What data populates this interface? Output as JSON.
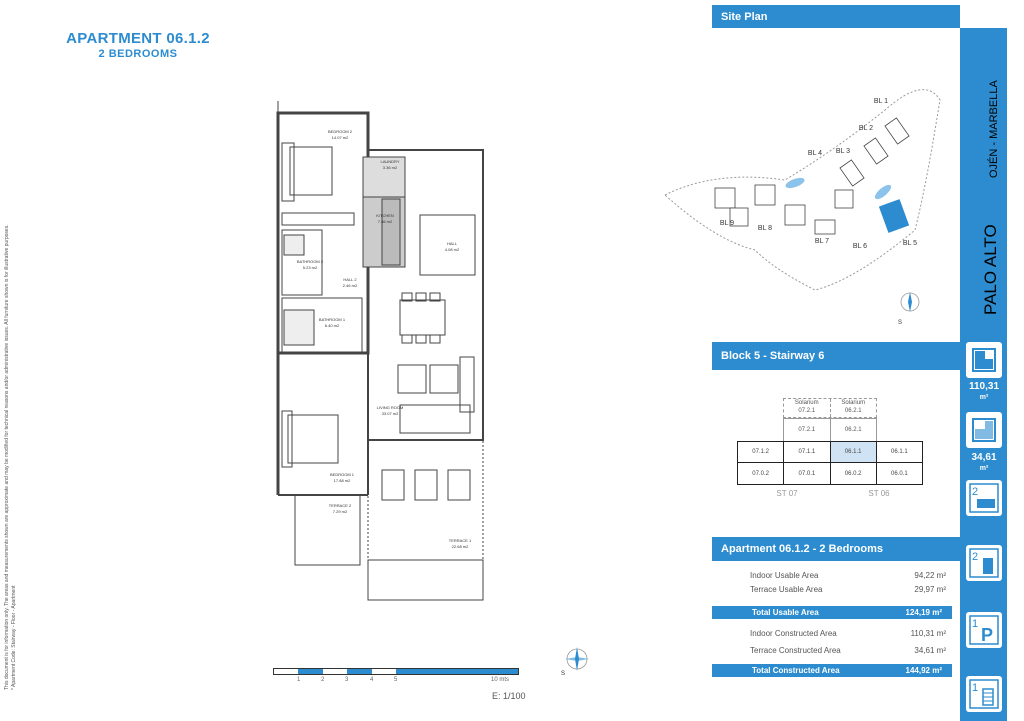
{
  "header": {
    "title": "APARTMENT 06.1.2",
    "subtitle": "2 BEDROOMS"
  },
  "disclaimer": {
    "line1": "This document is for information only. The areas and measurements shown are approximate and may be modified for technical reasons and/or administrative issues. All furniture shown is for illustrative purposes.",
    "line2": "* Apartment Code: Stairway - Floor - Apartment"
  },
  "floorplan": {
    "rooms": [
      {
        "name": "BEDROOM 2",
        "area": "14.07 m2"
      },
      {
        "name": "LAUNDRY",
        "area": "3.36 m2"
      },
      {
        "name": "KITCHEN",
        "area": "7.86 m2"
      },
      {
        "name": "HALL",
        "area": "4.08 m2"
      },
      {
        "name": "BATHROOM 2",
        "area": "5.23 m2"
      },
      {
        "name": "HALL 2",
        "area": "2.46 m2"
      },
      {
        "name": "BATHROOM 1",
        "area": "6.40 m2"
      },
      {
        "name": "LIVING ROOM",
        "area": "33.07 m2"
      },
      {
        "name": "BEDROOM 1",
        "area": "17.88 m2"
      },
      {
        "name": "TERRACE 2",
        "area": "7.29 m2"
      },
      {
        "name": "TERRACE 1",
        "area": "22.68 m2"
      }
    ],
    "scale_ticks": [
      "1",
      "2",
      "3",
      "4",
      "5",
      "10 mts"
    ],
    "scale_label": "E: 1/100",
    "compass_label": "S"
  },
  "site_plan": {
    "title": "Site Plan",
    "blocks": [
      "BL 1",
      "BL 2",
      "BL 3",
      "BL 4",
      "BL 9",
      "BL 8",
      "BL 7",
      "BL 6",
      "BL 5"
    ],
    "compass_label": "S"
  },
  "block_section": {
    "title": "Block 5 - Stairway 6",
    "solarium": [
      {
        "label": "Solarium",
        "code": "07.2.1"
      },
      {
        "label": "Solarium",
        "code": "06.2.1"
      }
    ],
    "row2": [
      "07.2.1",
      "06.2.1"
    ],
    "row1": [
      "07.1.2",
      "07.1.1",
      "06.1.1",
      "06.1.1"
    ],
    "row1_highlight": "06.1.1",
    "row0": [
      "07.0.2",
      "07.0.1",
      "06.0.2",
      "06.0.1"
    ],
    "stairways": [
      "ST 07",
      "ST 06"
    ]
  },
  "apartment_summary": {
    "title": "Apartment 06.1.2 - 2 Bedrooms",
    "indoor_usable_label": "Indoor Usable Area",
    "indoor_usable_value": "94,22 m²",
    "terrace_usable_label": "Terrace Usable Area",
    "terrace_usable_value": "29,97 m²",
    "total_usable_label": "Total Usable Area",
    "total_usable_value": "124,19 m²",
    "indoor_constructed_label": "Indoor Constructed Area",
    "indoor_constructed_value": "110,31 m²",
    "terrace_constructed_label": "Terrace Constructed Area",
    "terrace_constructed_value": "34,61 m²",
    "total_constructed_label": "Total Constructed Area",
    "total_constructed_value": "144,92 m²"
  },
  "brand": {
    "name": "PALO ALTO",
    "location": "OJÉN - MARBELLA"
  },
  "sidebar_icons": [
    {
      "icon": "indoor-area-icon",
      "value": "110,31",
      "unit": "m²"
    },
    {
      "icon": "terrace-area-icon",
      "value": "34,61",
      "unit": "m²"
    },
    {
      "icon": "bedroom-icon",
      "count": "2"
    },
    {
      "icon": "bathroom-icon",
      "count": "2"
    },
    {
      "icon": "parking-icon",
      "count": "1"
    },
    {
      "icon": "storage-icon",
      "count": "1"
    }
  ],
  "colors": {
    "accent": "#2d8ccf",
    "highlight": "#5ea8dc"
  }
}
